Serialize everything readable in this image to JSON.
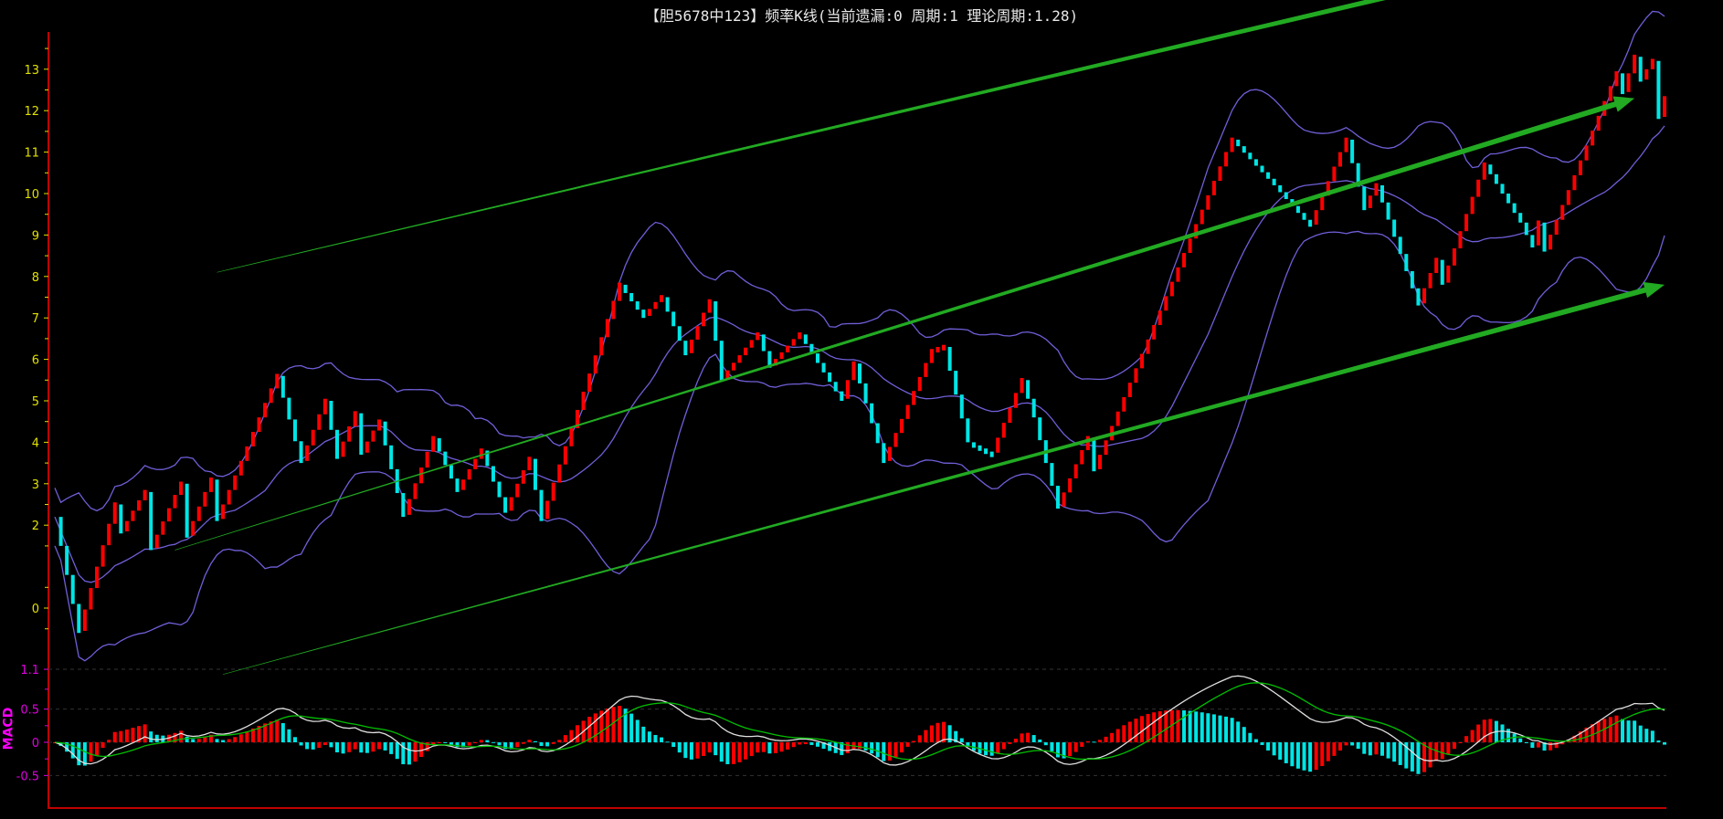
{
  "title": "【胆5678中123】频率K线(当前遗漏:0 周期:1 理论周期:1.28)",
  "colors": {
    "up": "#ff0000",
    "down": "#00e5e5",
    "band": "#6f5fd8",
    "trend": "#22aa22",
    "dif": "#e0e0e0",
    "dea": "#00c000",
    "axis": "#c00000",
    "price_tick": "#e0e000",
    "macd_tick": "#e000e0"
  },
  "chart_data": [
    {
      "type": "candlestick",
      "name": "frequency-kline",
      "ylim": [
        -1,
        14
      ],
      "yticks": [
        "0",
        "2",
        "3",
        "4",
        "5",
        "6",
        "7",
        "8",
        "9",
        "10",
        "11",
        "12",
        "13"
      ],
      "ytick_values": [
        0,
        2,
        3,
        4,
        5,
        6,
        7,
        8,
        9,
        10,
        11,
        12,
        13
      ],
      "pivots": [
        [
          0,
          2.2
        ],
        [
          4,
          -0.6
        ],
        [
          10,
          2.5
        ],
        [
          11,
          1.8
        ],
        [
          15,
          2.8
        ],
        [
          16,
          1.4
        ],
        [
          21,
          3.0
        ],
        [
          22,
          1.7
        ],
        [
          26,
          3.1
        ],
        [
          27,
          2.1
        ],
        [
          37,
          5.6
        ],
        [
          41,
          3.5
        ],
        [
          45,
          5.0
        ],
        [
          47,
          3.6
        ],
        [
          50,
          4.7
        ],
        [
          51,
          3.7
        ],
        [
          54,
          4.5
        ],
        [
          58,
          2.2
        ],
        [
          63,
          4.1
        ],
        [
          67,
          2.8
        ],
        [
          71,
          3.8
        ],
        [
          75,
          2.3
        ],
        [
          79,
          3.6
        ],
        [
          81,
          2.1
        ],
        [
          94,
          7.8
        ],
        [
          98,
          7.0
        ],
        [
          101,
          7.5
        ],
        [
          105,
          6.1
        ],
        [
          109,
          7.4
        ],
        [
          111,
          5.5
        ],
        [
          117,
          6.6
        ],
        [
          119,
          5.8
        ],
        [
          124,
          6.6
        ],
        [
          131,
          5.0
        ],
        [
          133,
          5.9
        ],
        [
          138,
          3.5
        ],
        [
          146,
          6.2
        ],
        [
          148,
          6.3
        ],
        [
          152,
          4.0
        ],
        [
          156,
          3.7
        ],
        [
          161,
          5.5
        ],
        [
          163,
          4.6
        ],
        [
          167,
          2.4
        ],
        [
          172,
          4.1
        ],
        [
          173,
          3.3
        ],
        [
          196,
          11.3
        ],
        [
          203,
          10.2
        ],
        [
          209,
          9.2
        ],
        [
          215,
          11.3
        ],
        [
          218,
          9.6
        ],
        [
          220,
          10.2
        ],
        [
          227,
          7.3
        ],
        [
          230,
          8.4
        ],
        [
          231,
          7.8
        ],
        [
          238,
          10.7
        ],
        [
          244,
          9.3
        ],
        [
          246,
          8.7
        ],
        [
          247,
          9.3
        ],
        [
          248,
          8.6
        ],
        [
          260,
          12.9
        ],
        [
          261,
          12.4
        ],
        [
          263,
          13.3
        ],
        [
          264,
          12.7
        ],
        [
          266,
          13.2
        ],
        [
          267,
          11.8
        ],
        [
          268,
          12.3
        ]
      ],
      "bollinger": {
        "period": 20,
        "k": 2
      },
      "trend_lines": [
        [
          [
            27,
            8.1
          ],
          [
            253,
            15.8
          ]
        ],
        [
          [
            20,
            1.4
          ],
          [
            263,
            12.3
          ]
        ],
        [
          [
            28,
            -1.6
          ],
          [
            268,
            7.8
          ]
        ]
      ]
    },
    {
      "type": "macd",
      "label": "MACD",
      "ylim": [
        -0.6,
        1.15
      ],
      "yticks": [
        "1.1",
        "0.5",
        "0",
        "-0.5"
      ],
      "ytick_values": [
        1.1,
        0.5,
        0,
        -0.5
      ],
      "params": {
        "fast": 12,
        "slow": 26,
        "signal": 9
      }
    }
  ]
}
